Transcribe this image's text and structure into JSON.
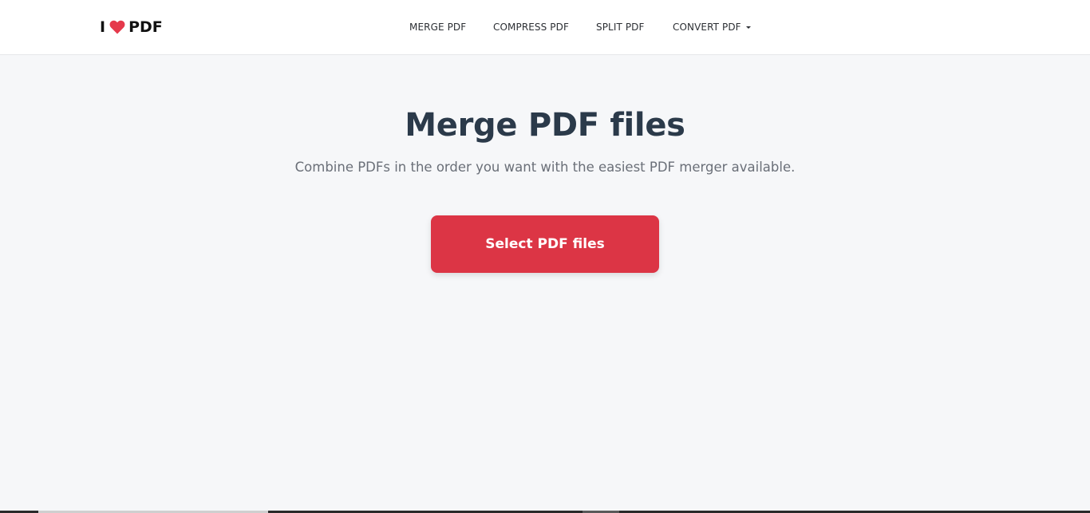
{
  "brand": {
    "prefix": "I",
    "suffix": "PDF",
    "heart_icon": "heart-icon",
    "heart_color": "#e5394b"
  },
  "nav": {
    "items": [
      {
        "label": "MERGE PDF"
      },
      {
        "label": "COMPRESS PDF"
      },
      {
        "label": "SPLIT PDF"
      },
      {
        "label": "CONVERT PDF",
        "icon": "caret-down-icon"
      }
    ]
  },
  "hero": {
    "title": "Merge PDF files",
    "subtitle": "Combine PDFs in the order you want with the easiest PDF merger available.",
    "cta_label": "Select PDF files"
  },
  "colors": {
    "accent": "#dc3545",
    "title": "#2b3a4a",
    "background": "#f6f7f9"
  }
}
